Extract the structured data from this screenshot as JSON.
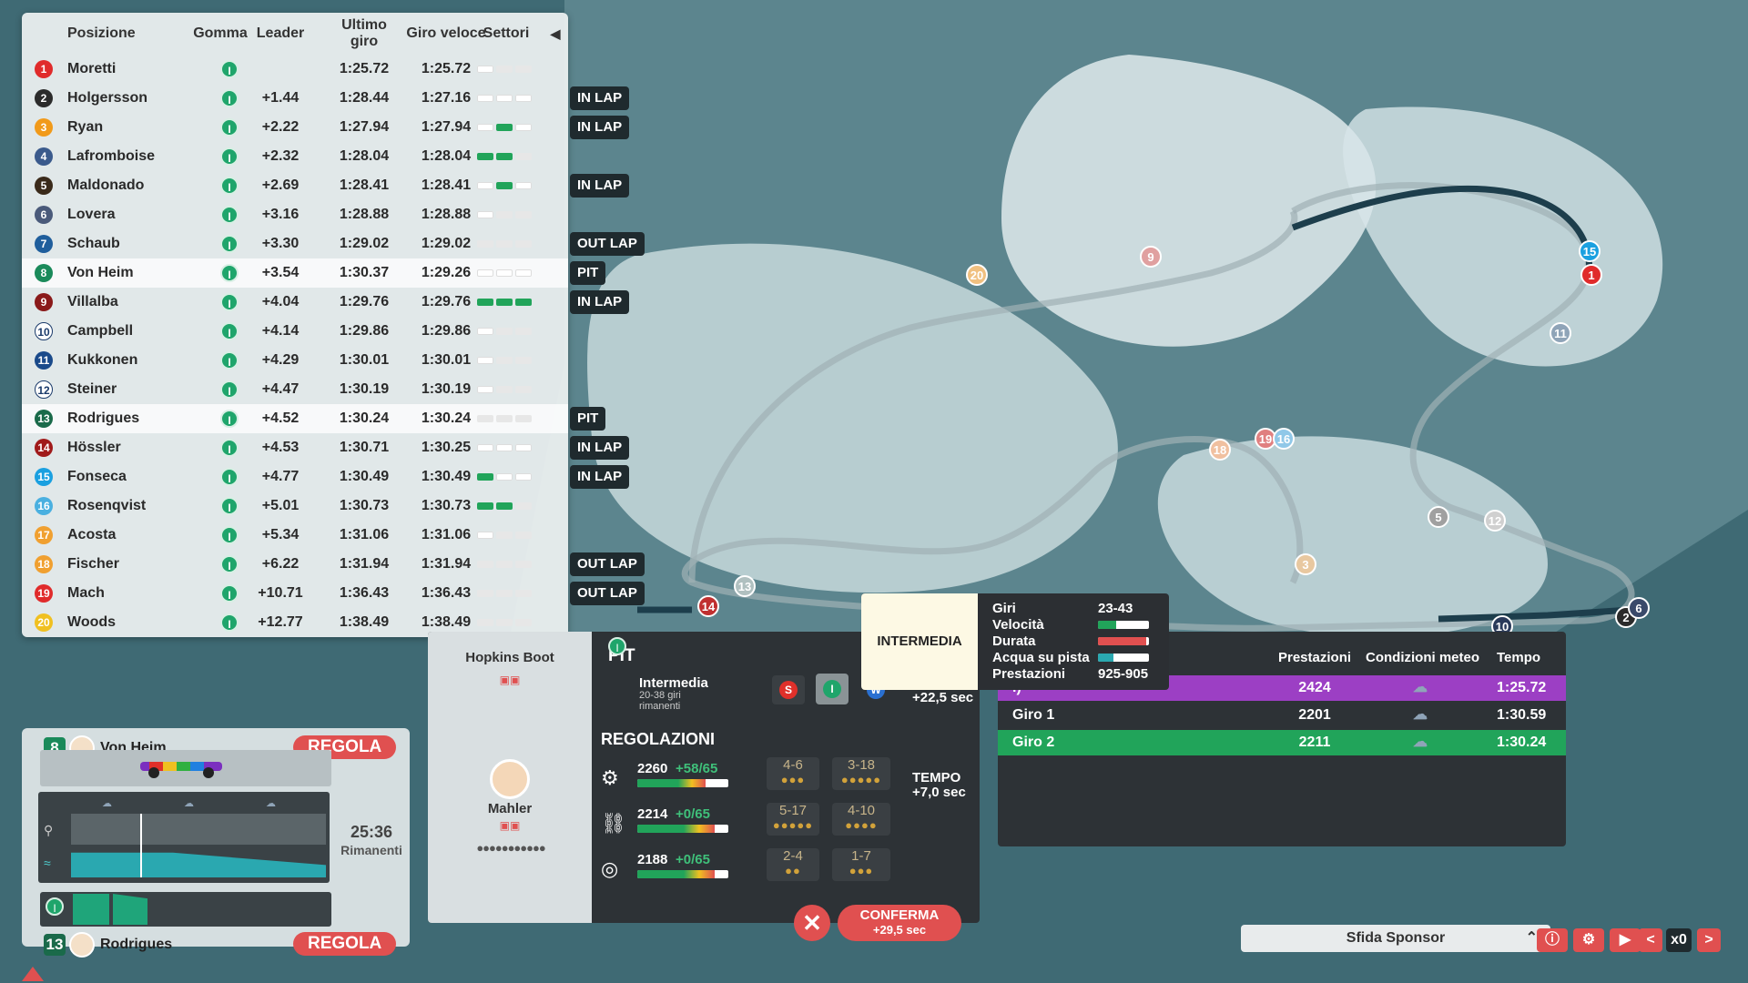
{
  "standings": {
    "headers": {
      "position": "Posizione",
      "tyre": "Gomma",
      "leader": "Leader",
      "last_lap": "Ultimo giro",
      "fastest_lap": "Giro veloce",
      "sectors": "Settori",
      "collapse_icon": "chevron-left-icon"
    },
    "rows": [
      {
        "pos": "1",
        "name": "Moretti",
        "tyre": "I",
        "gap": "",
        "last": "1:25.72",
        "best": "1:25.72",
        "color": "#e02b2b",
        "sectors": [
          "w",
          "n",
          "n"
        ],
        "status": ""
      },
      {
        "pos": "2",
        "name": "Holgersson",
        "tyre": "I",
        "gap": "+1.44",
        "last": "1:28.44",
        "best": "1:27.16",
        "color": "#2b2b2b",
        "sectors": [
          "w",
          "w",
          "w"
        ],
        "status": "IN LAP"
      },
      {
        "pos": "3",
        "name": "Ryan",
        "tyre": "I",
        "gap": "+2.22",
        "last": "1:27.94",
        "best": "1:27.94",
        "color": "#f19a1a",
        "sectors": [
          "w",
          "g",
          "w"
        ],
        "status": "IN LAP"
      },
      {
        "pos": "4",
        "name": "Lafromboise",
        "tyre": "I",
        "gap": "+2.32",
        "last": "1:28.04",
        "best": "1:28.04",
        "color": "#3a5a8c",
        "sectors": [
          "g",
          "g",
          "n"
        ],
        "status": ""
      },
      {
        "pos": "5",
        "name": "Maldonado",
        "tyre": "I",
        "gap": "+2.69",
        "last": "1:28.41",
        "best": "1:28.41",
        "color": "#3a2a1a",
        "sectors": [
          "w",
          "g",
          "w"
        ],
        "status": "IN LAP"
      },
      {
        "pos": "6",
        "name": "Lovera",
        "tyre": "I",
        "gap": "+3.16",
        "last": "1:28.88",
        "best": "1:28.88",
        "color": "#4a5a7a",
        "sectors": [
          "w",
          "n",
          "n"
        ],
        "status": ""
      },
      {
        "pos": "7",
        "name": "Schaub",
        "tyre": "I",
        "gap": "+3.30",
        "last": "1:29.02",
        "best": "1:29.02",
        "color": "#1f5e9c",
        "sectors": [
          "n",
          "n",
          "n"
        ],
        "status": "OUT LAP"
      },
      {
        "pos": "8",
        "name": "Von Heim",
        "tyre": "I",
        "gap": "+3.54",
        "last": "1:30.37",
        "best": "1:29.26",
        "color": "#1a8a5a",
        "sectors": [
          "w",
          "w",
          "w"
        ],
        "status": "PIT"
      },
      {
        "pos": "9",
        "name": "Villalba",
        "tyre": "I",
        "gap": "+4.04",
        "last": "1:29.76",
        "best": "1:29.76",
        "color": "#8a1a1a",
        "sectors": [
          "g",
          "g",
          "g"
        ],
        "status": "IN LAP"
      },
      {
        "pos": "10",
        "name": "Campbell",
        "tyre": "I",
        "gap": "+4.14",
        "last": "1:29.86",
        "best": "1:29.86",
        "color": "#ffffff",
        "sectors": [
          "w",
          "n",
          "n"
        ],
        "status": ""
      },
      {
        "pos": "11",
        "name": "Kukkonen",
        "tyre": "I",
        "gap": "+4.29",
        "last": "1:30.01",
        "best": "1:30.01",
        "color": "#1a4a8a",
        "sectors": [
          "w",
          "n",
          "n"
        ],
        "status": ""
      },
      {
        "pos": "12",
        "name": "Steiner",
        "tyre": "I",
        "gap": "+4.47",
        "last": "1:30.19",
        "best": "1:30.19",
        "color": "#ffffff",
        "sectors": [
          "w",
          "n",
          "n"
        ],
        "status": ""
      },
      {
        "pos": "13",
        "name": "Rodrigues",
        "tyre": "I",
        "gap": "+4.52",
        "last": "1:30.24",
        "best": "1:30.24",
        "color": "#1a6a4a",
        "sectors": [
          "n",
          "n",
          "n"
        ],
        "status": "PIT"
      },
      {
        "pos": "14",
        "name": "Hössler",
        "tyre": "I",
        "gap": "+4.53",
        "last": "1:30.71",
        "best": "1:30.25",
        "color": "#a01a1a",
        "sectors": [
          "w",
          "w",
          "w"
        ],
        "status": "IN LAP"
      },
      {
        "pos": "15",
        "name": "Fonseca",
        "tyre": "I",
        "gap": "+4.77",
        "last": "1:30.49",
        "best": "1:30.49",
        "color": "#1aa0e0",
        "sectors": [
          "g",
          "w",
          "w"
        ],
        "status": "IN LAP"
      },
      {
        "pos": "16",
        "name": "Rosenqvist",
        "tyre": "I",
        "gap": "+5.01",
        "last": "1:30.73",
        "best": "1:30.73",
        "color": "#4ab0e0",
        "sectors": [
          "g",
          "g",
          "n"
        ],
        "status": ""
      },
      {
        "pos": "17",
        "name": "Acosta",
        "tyre": "I",
        "gap": "+5.34",
        "last": "1:31.06",
        "best": "1:31.06",
        "color": "#f0a030",
        "sectors": [
          "w",
          "n",
          "n"
        ],
        "status": ""
      },
      {
        "pos": "18",
        "name": "Fischer",
        "tyre": "I",
        "gap": "+6.22",
        "last": "1:31.94",
        "best": "1:31.94",
        "color": "#f0a030",
        "sectors": [
          "n",
          "n",
          "n"
        ],
        "status": "OUT LAP"
      },
      {
        "pos": "19",
        "name": "Mach",
        "tyre": "I",
        "gap": "+10.71",
        "last": "1:36.43",
        "best": "1:36.43",
        "color": "#e02b2b",
        "sectors": [
          "n",
          "n",
          "n"
        ],
        "status": "OUT LAP"
      },
      {
        "pos": "20",
        "name": "Woods",
        "tyre": "I",
        "gap": "+12.77",
        "last": "1:38.49",
        "best": "1:38.49",
        "color": "#f0c020",
        "sectors": [
          "n",
          "n",
          "n"
        ],
        "status": ""
      }
    ]
  },
  "map_markers": [
    {
      "label": "15",
      "color": "#1aa0e0"
    },
    {
      "label": "1",
      "color": "#e02b2b"
    },
    {
      "label": "11",
      "color": "#8fa4b8"
    },
    {
      "label": "9",
      "color": "#e0a0a0"
    },
    {
      "label": "20",
      "color": "#f0c080"
    },
    {
      "label": "18",
      "color": "#f0c0a0"
    },
    {
      "label": "19",
      "color": "#e08080"
    },
    {
      "label": "16",
      "color": "#90c8e8"
    },
    {
      "label": "5",
      "color": "#a0a0a0"
    },
    {
      "label": "12",
      "color": "#d0d0d0"
    },
    {
      "label": "3",
      "color": "#e8c8a0"
    },
    {
      "label": "13",
      "color": "#b0c0c0"
    },
    {
      "label": "14",
      "color": "#c03030"
    },
    {
      "label": "10",
      "color": "#2a3a5a"
    },
    {
      "label": "2",
      "color": "#2b2b2b"
    },
    {
      "label": "6",
      "color": "#3a4a6a"
    }
  ],
  "car_panel": {
    "driver1": {
      "number": "8",
      "name": "Von Heim",
      "button": "REGOLA"
    },
    "driver2": {
      "number": "13",
      "name": "Rodrigues",
      "button": "REGOLA"
    },
    "time_remaining": "25:36",
    "remaining_label": "Rimanenti",
    "tyre": "I",
    "weather_icon": "cloud-rain-icon",
    "rain_icon": "rain-gauge-icon",
    "water_icon": "water-icon"
  },
  "pit_panel": {
    "engineer_title": "Hopkins Boot",
    "engineer_name": "Mahler",
    "section_title": "PIT",
    "tyre_name": "Intermedia",
    "tyre_laps": "20-38 giri",
    "tyre_sub": "rimanenti",
    "tyre_options": [
      "S",
      "I",
      "W"
    ],
    "tyre_time": "+22,5 sec",
    "settings_title": "REGOLAZIONI",
    "time_label": "TEMPO",
    "time_value": "+7,0 sec",
    "rows": [
      {
        "icon": "engine-icon",
        "value": "2260",
        "delta": "+58/65",
        "fill": 0.75,
        "s1": "4-6",
        "s1dots": "●●●",
        "s2": "3-18",
        "s2dots": "●●●●●"
      },
      {
        "icon": "gearbox-icon",
        "value": "2214",
        "delta": "+0/65",
        "fill": 0.85,
        "s1": "5-17",
        "s1dots": "●●●●●",
        "s2": "4-10",
        "s2dots": "●●●●"
      },
      {
        "icon": "brake-icon",
        "value": "2188",
        "delta": "+0/65",
        "fill": 0.85,
        "s1": "2-4",
        "s1dots": "●●",
        "s2": "1-7",
        "s2dots": "●●●"
      }
    ],
    "cancel_icon": "close-icon",
    "confirm_label": "CONFERMA",
    "confirm_time": "+29,5 sec"
  },
  "tooltip": {
    "tyre_type": "INTERMEDIA",
    "rows": [
      {
        "label": "Giri",
        "value": "23-43"
      },
      {
        "label": "Velocità",
        "value": ""
      },
      {
        "label": "Durata",
        "value": ""
      },
      {
        "label": "Acqua su pista",
        "value": ""
      },
      {
        "label": "Prestazioni",
        "value": "925-905"
      }
    ]
  },
  "laps_panel": {
    "headers": {
      "perf": "Prestazioni",
      "weather": "Condizioni meteo",
      "time": "Tempo"
    },
    "rows": [
      {
        "name": "i)",
        "perf": "2424",
        "time": "1:25.72",
        "bg": "#9c3fc4"
      },
      {
        "name": "Giro 1",
        "perf": "2201",
        "time": "1:30.59",
        "bg": "transparent"
      },
      {
        "name": "Giro 2",
        "perf": "2211",
        "time": "1:30.24",
        "bg": "#21a45a"
      }
    ]
  },
  "bottom_bar": {
    "sponsor_label": "Sfida Sponsor",
    "speed": "x0"
  }
}
